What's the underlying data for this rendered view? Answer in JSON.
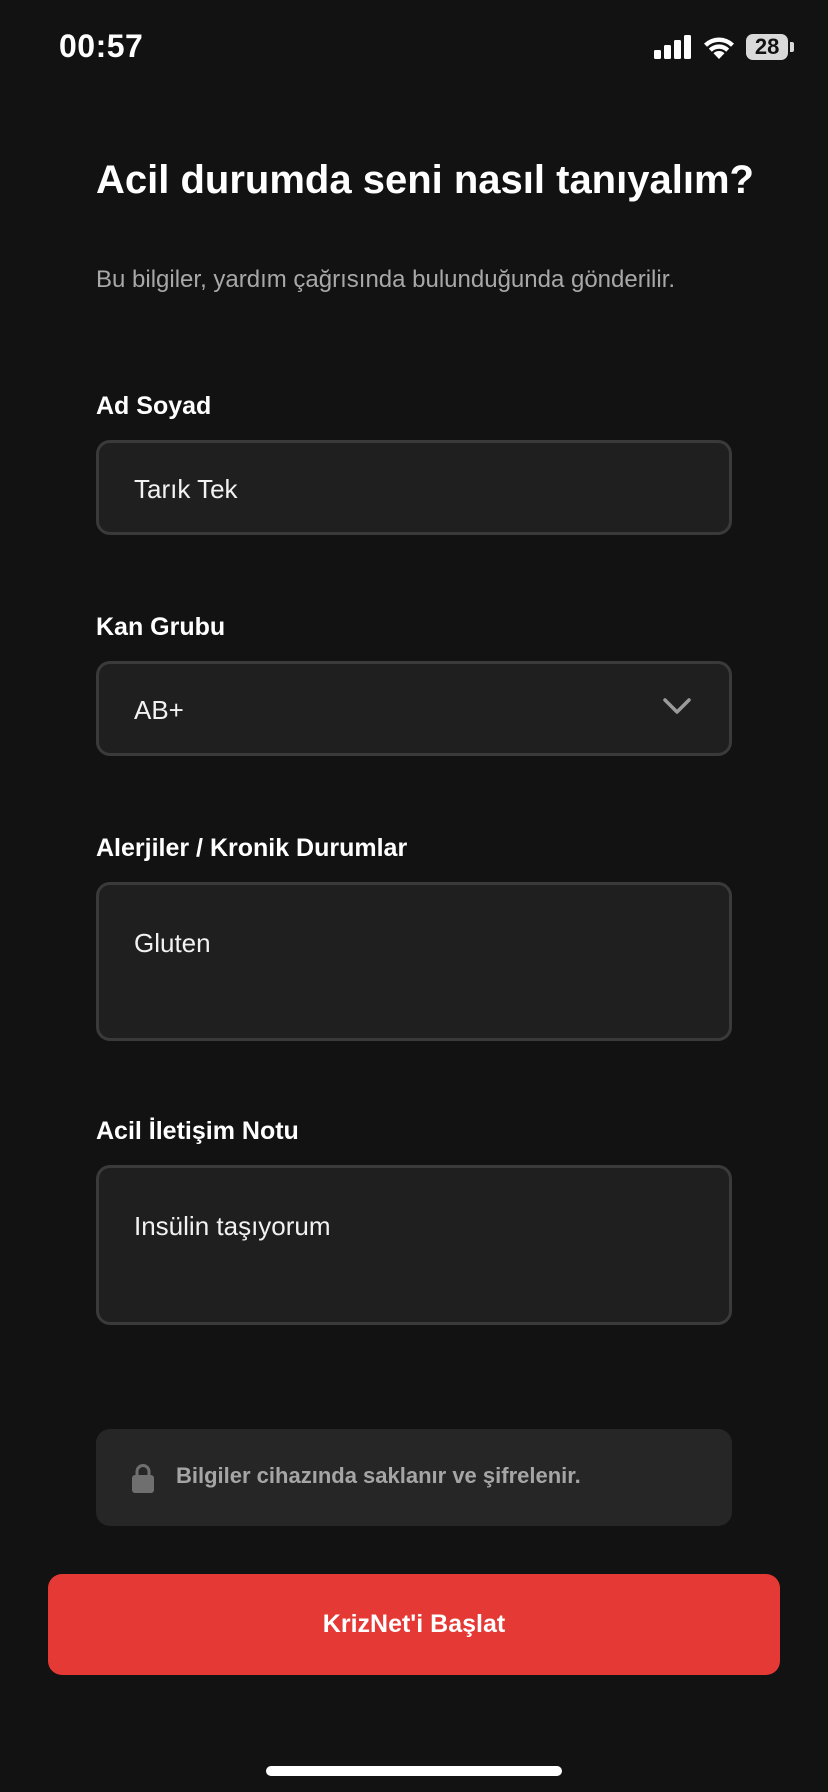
{
  "status_bar": {
    "time": "00:57",
    "battery_level": "28",
    "icons": [
      "cellular-signal-icon",
      "wifi-icon",
      "battery-icon"
    ]
  },
  "header": {
    "title": "Acil durumda seni nasıl tanıyalım?",
    "subtitle": "Bu bilgiler, yardım çağrısında bulunduğunda gönderilir."
  },
  "form": {
    "name": {
      "label": "Ad Soyad",
      "value": "Tarık Tek"
    },
    "blood_type": {
      "label": "Kan Grubu",
      "value": "AB+"
    },
    "allergies": {
      "label": "Alerjiler / Kronik Durumlar",
      "value": "Gluten"
    },
    "emergency_note": {
      "label": "Acil İletişim Notu",
      "value": "Insülin taşıyorum"
    }
  },
  "info": {
    "icon": "lock-icon",
    "text": "Bilgiler cihazında saklanır ve şifrelenir."
  },
  "actions": {
    "start_label": "KrizNet'i Başlat"
  },
  "colors": {
    "background": "#121212",
    "accent": "#e53935",
    "field_bg": "#1f1f1f",
    "field_border": "#3a3a3a"
  }
}
